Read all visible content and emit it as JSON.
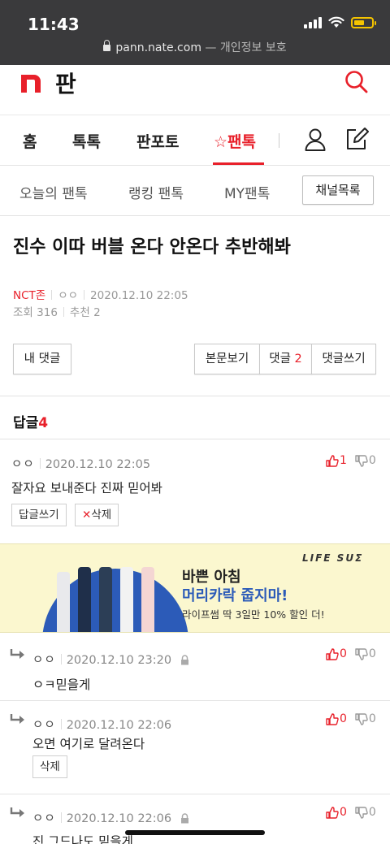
{
  "status": {
    "time": "11:43"
  },
  "browser": {
    "url": "pann.nate.com",
    "url_sub": "— 개인정보 보호"
  },
  "header": {
    "logo_text": "판"
  },
  "nav": {
    "home": "홈",
    "toktok": "톡톡",
    "panpoto": "판포토",
    "fantok": "☆팬톡"
  },
  "subnav": {
    "today": "오늘의 팬톡",
    "ranking": "랭킹 팬톡",
    "my": "MY팬톡",
    "channel_list": "채널목록"
  },
  "post": {
    "title": "진수 이따 버블 온다 안온다 추반해봐",
    "category": "NCT존",
    "author": "ㅇㅇ",
    "datetime": "2020.12.10 22:05",
    "views_label": "조회",
    "views": "316",
    "recommend_label": "추천",
    "recommend": "2"
  },
  "buttons": {
    "my_comments": "내 댓글",
    "view_body": "본문보기",
    "comments_label": "댓글",
    "comments_count": "2",
    "write_comment": "댓글쓰기"
  },
  "replies": {
    "label": "답글",
    "count": "4"
  },
  "comments": [
    {
      "author": "ㅇㅇ",
      "datetime": "2020.12.10 22:05",
      "text": "잘자요 보내준다 진짜 믿어봐",
      "up": "1",
      "down": "0",
      "reply_btn": "답글쓰기",
      "delete_btn": "삭제"
    },
    {
      "author": "ㅇㅇ",
      "datetime": "2020.12.10 23:20",
      "text": "ㅇㅋ믿을게",
      "up": "0",
      "down": "0"
    },
    {
      "author": "ㅇㅇ",
      "datetime": "2020.12.10 22:06",
      "text": "오면 여기로 달려온다",
      "up": "0",
      "down": "0",
      "delete_btn": "삭제"
    },
    {
      "author": "ㅇㅇ",
      "datetime": "2020.12.10 22:06",
      "text": "진 그드나도 믿을게",
      "up": "0",
      "down": "0"
    }
  ],
  "ad": {
    "brand": "LIFE SUΣ",
    "line1": "바쁜 아침",
    "line2": "머리카락 줍지마!",
    "line3": "라이프썸 딱 3일만 10% 할인 더!",
    "accent_color": "#2c5bb8"
  },
  "colors": {
    "accent": "#e8202a"
  }
}
